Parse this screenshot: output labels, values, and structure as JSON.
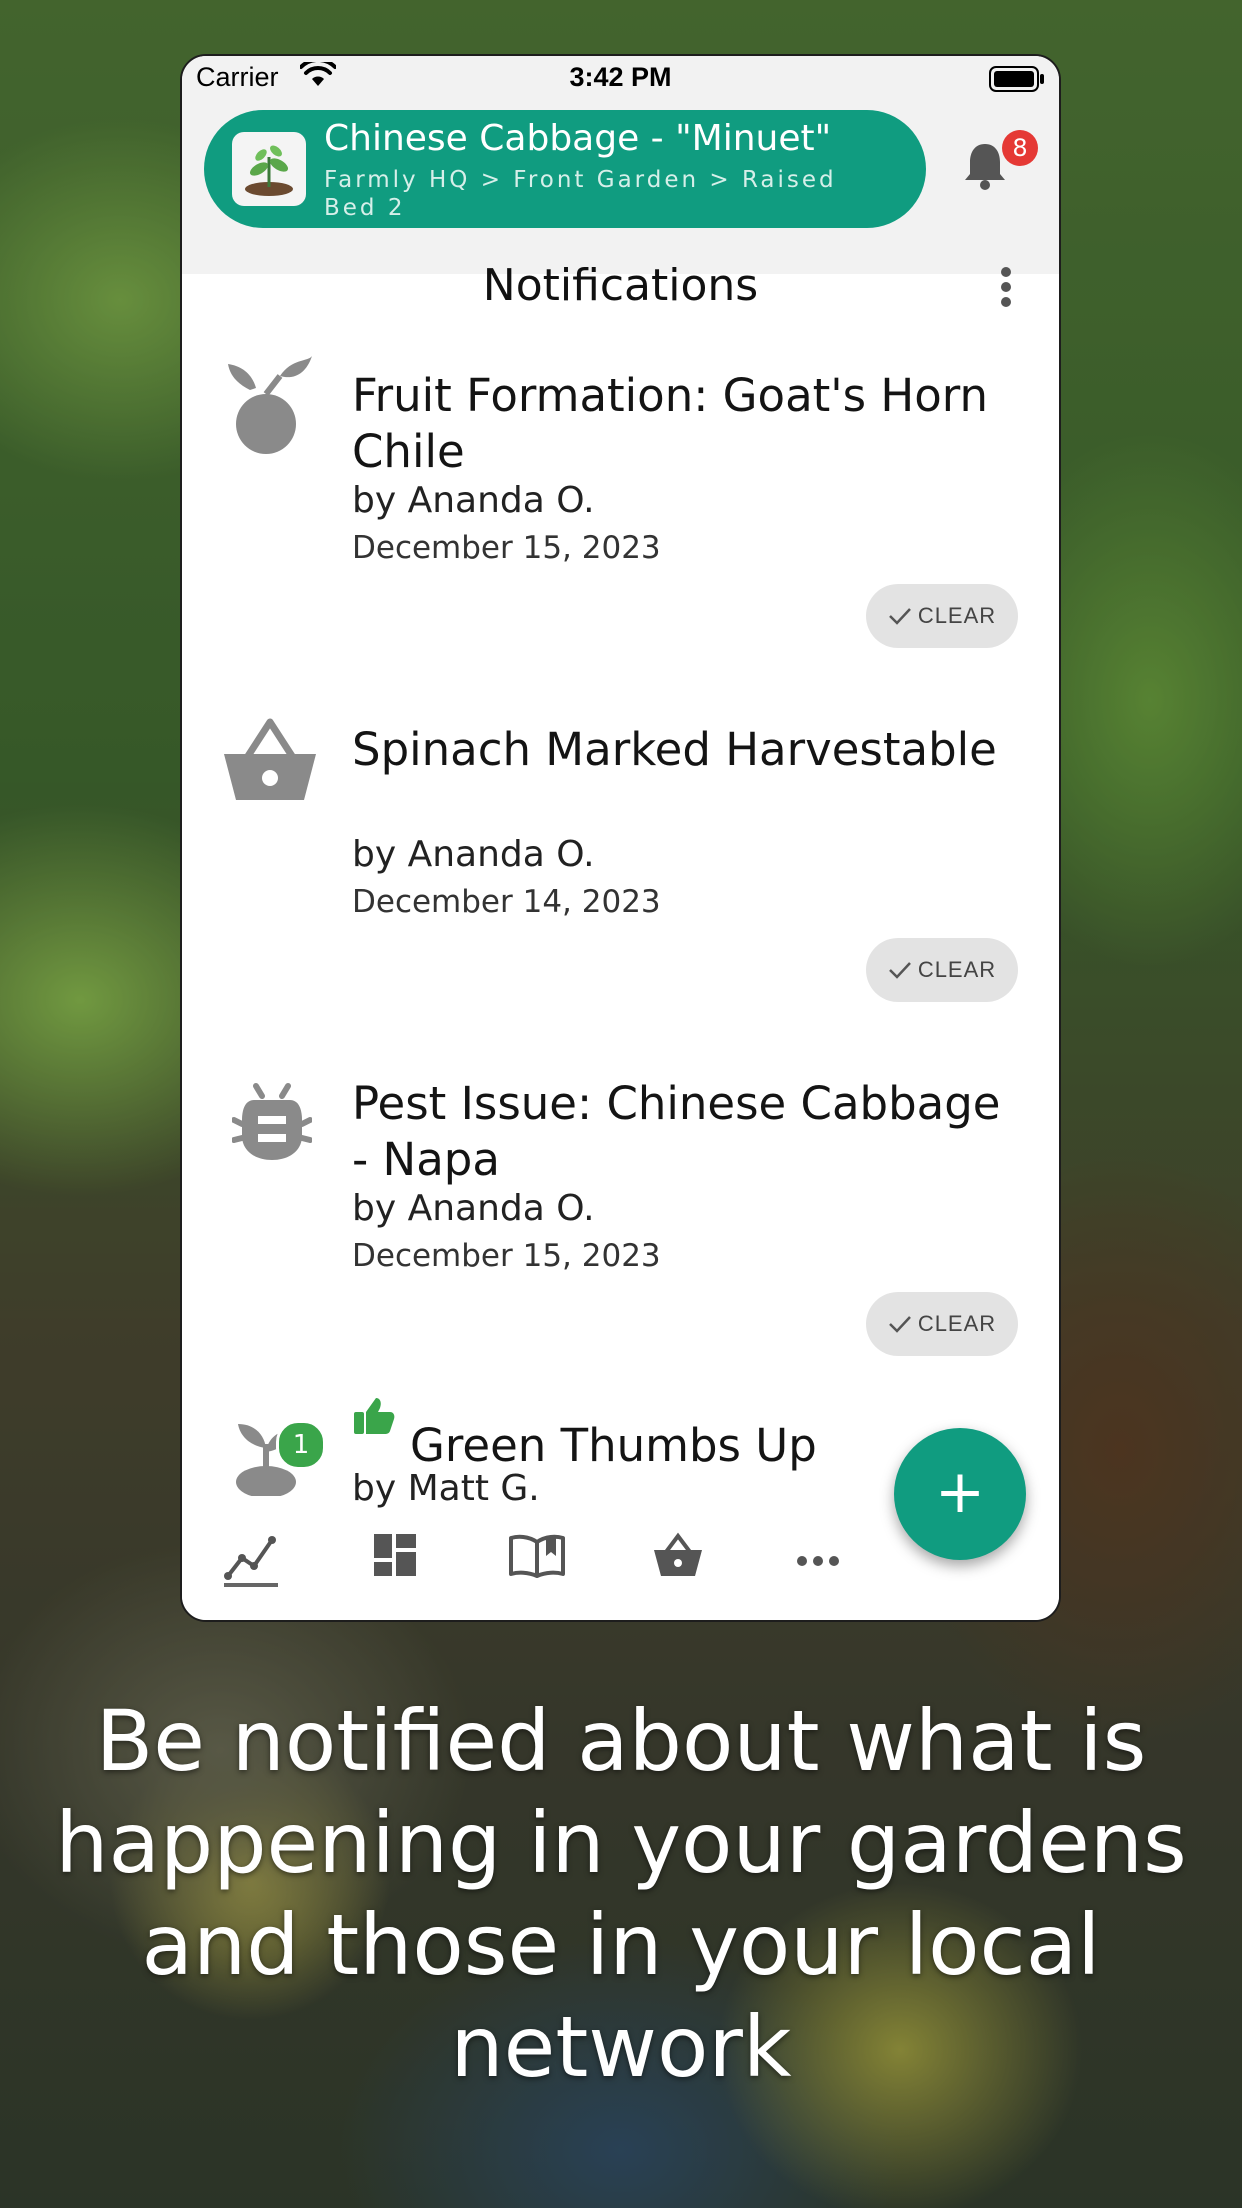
{
  "status_bar": {
    "carrier": "Carrier",
    "time": "3:42 PM"
  },
  "header": {
    "plant_name": "Chinese Cabbage - \"Minuet\"",
    "breadcrumb": "Farmly HQ > Front Garden > Raised Bed 2",
    "notification_count": "8",
    "accent_color": "#109c80"
  },
  "panel": {
    "title": "Notifications"
  },
  "notifications": [
    {
      "icon": "fruit-icon",
      "title": "Fruit Formation: Goat's Horn Chile",
      "author": "by Ananda O.",
      "date": "December 15, 2023",
      "clear_label": "CLEAR"
    },
    {
      "icon": "basket-icon",
      "title": "Spinach Marked Harvestable",
      "author": "by Ananda O.",
      "date": "December 14, 2023",
      "clear_label": "CLEAR"
    },
    {
      "icon": "bug-icon",
      "title": "Pest Issue: Chinese Cabbage - Napa",
      "author": "by Ananda O.",
      "date": "December 15, 2023",
      "clear_label": "CLEAR"
    },
    {
      "icon": "sprout-icon",
      "badge": "1",
      "title": "Green Thumbs Up",
      "author": "by Matt G."
    }
  ],
  "bottom_nav": [
    {
      "icon": "chart-icon",
      "active": true
    },
    {
      "icon": "dashboard-icon",
      "active": false
    },
    {
      "icon": "book-icon",
      "active": false
    },
    {
      "icon": "basket-icon",
      "active": false
    },
    {
      "icon": "more-icon",
      "active": false
    }
  ],
  "fab": {
    "label": "+"
  },
  "caption": "Be notified about what is happening in your gardens and those in your local network"
}
